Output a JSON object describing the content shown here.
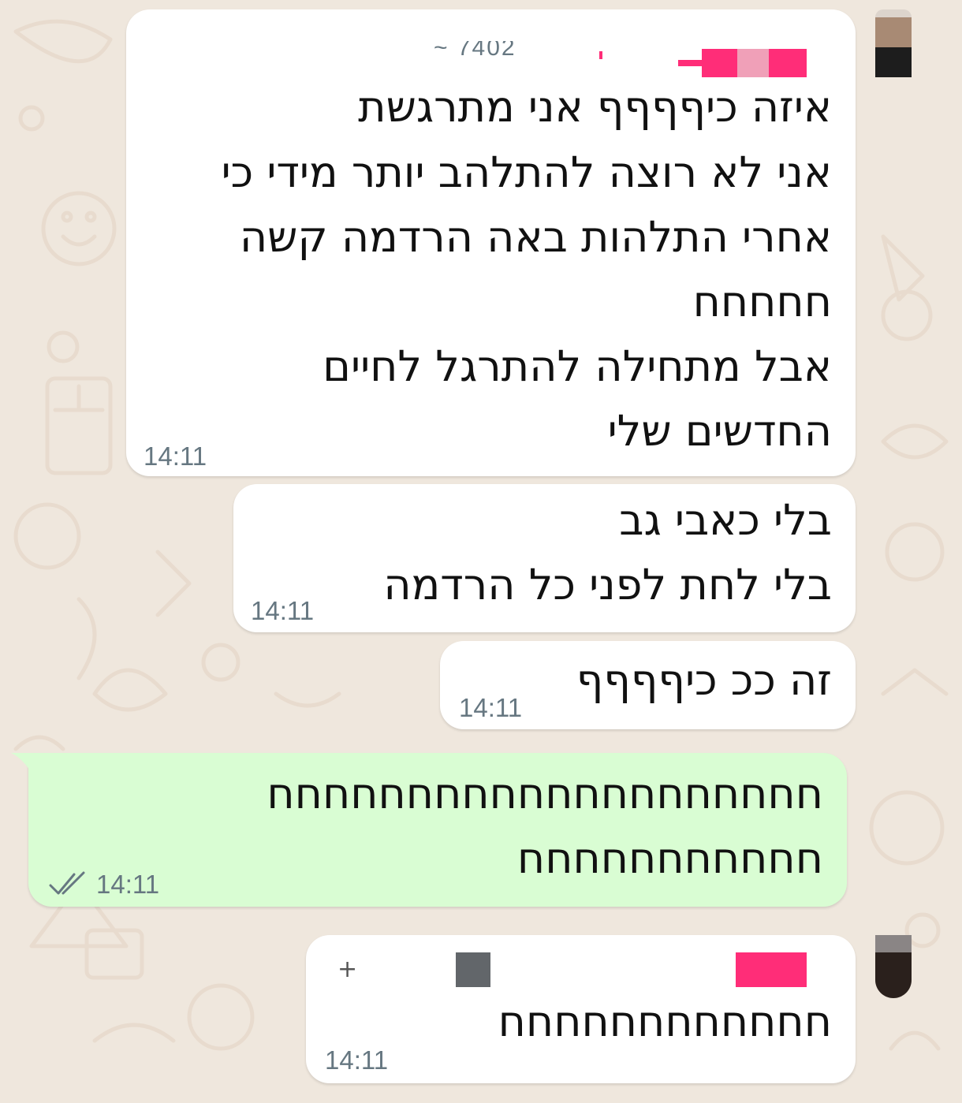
{
  "wallpaper": {
    "background": "#efe7dd",
    "doodle_color": "#e3d3c3"
  },
  "messages": [
    {
      "direction": "incoming",
      "sender_fragment": "~ 7402",
      "lines": [
        "איזה כיףףףף אני מתרגשת",
        "אני לא רוצה להתלהב יותר מידי כי",
        "אחרי התלהות באה הרדמה קשה",
        "חחחחח",
        "אבל מתחילה להתרגל לחיים",
        "החדשים שלי"
      ],
      "time": "14:11"
    },
    {
      "direction": "incoming",
      "lines": [
        "בלי כאבי גב",
        "בלי לחת לפני כל הרדמה"
      ],
      "time": "14:11"
    },
    {
      "direction": "incoming",
      "lines": [
        "זה ככ כיףףףף"
      ],
      "time": "14:11"
    },
    {
      "direction": "outgoing",
      "lines": [
        "חחחחחחחחחחחחחחחחחחחח",
        "חחחחחחחחחחח"
      ],
      "time": "14:11",
      "status": "read",
      "status_icon": "double-check-icon",
      "status_color": "#667781"
    },
    {
      "direction": "incoming",
      "sender_fragment": "+",
      "lines": [
        "חחחחחחחחחחחח"
      ],
      "time": "14:11"
    }
  ],
  "colors": {
    "incoming_bubble": "#ffffff",
    "outgoing_bubble": "#d9fdd3",
    "text": "#111111",
    "timestamp": "#667781",
    "redaction_pink": "#ff2d78",
    "redaction_light_pink": "#f0a0b8",
    "redaction_gray": "#62666a"
  }
}
